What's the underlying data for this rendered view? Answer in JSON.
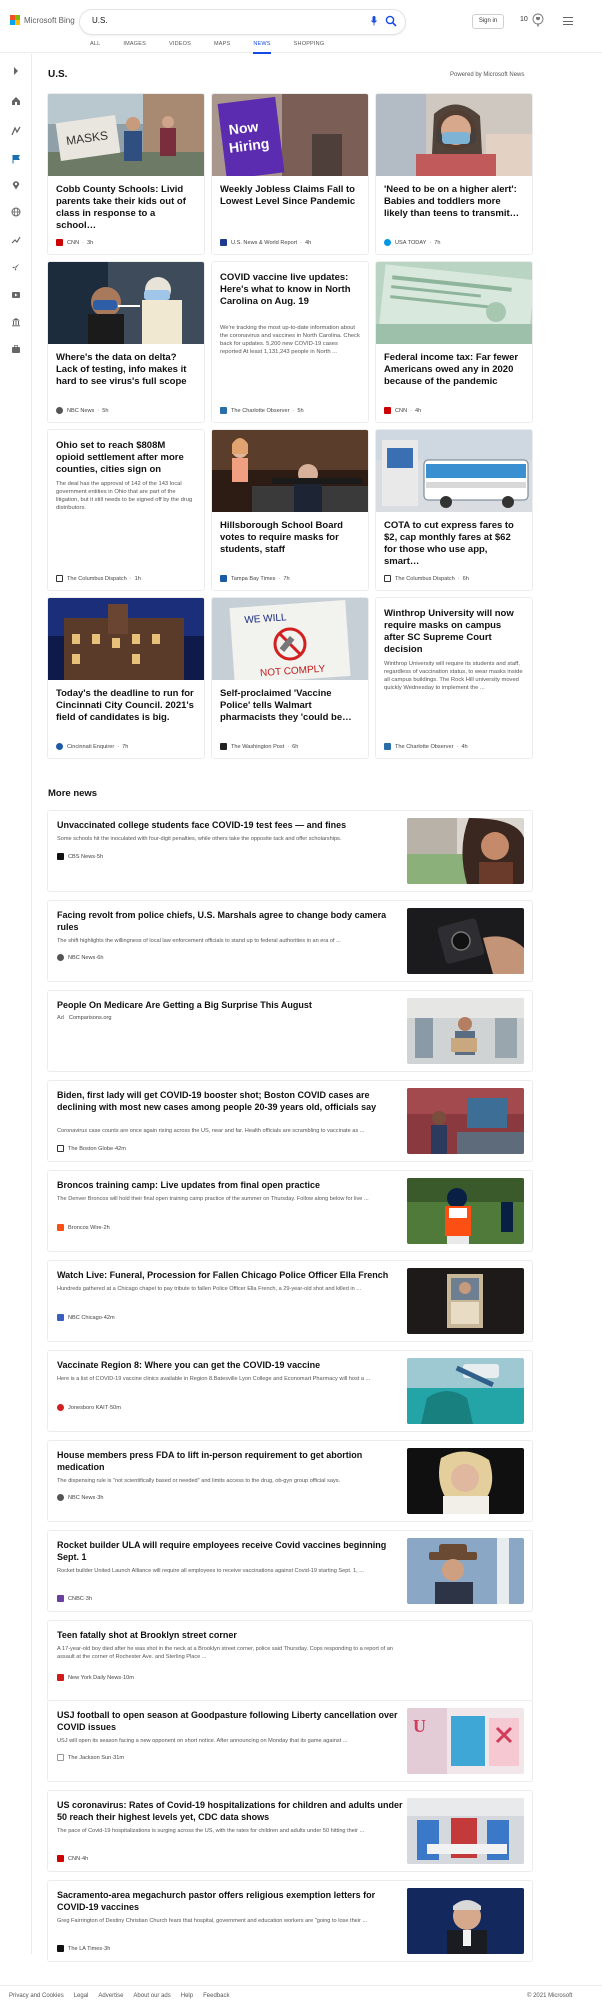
{
  "brand": {
    "logo_text": "Microsoft Bing",
    "logo_colors": [
      "#f25022",
      "#7fba00",
      "#00a4ef",
      "#ffb900"
    ],
    "accent": "#174ae4"
  },
  "search": {
    "value": "U.S."
  },
  "header": {
    "sign_in": "Sign in",
    "rewards_points": "10"
  },
  "tabs": [
    {
      "label": "ALL"
    },
    {
      "label": "IMAGES"
    },
    {
      "label": "VIDEOS"
    },
    {
      "label": "MAPS"
    },
    {
      "label": "NEWS",
      "active": true
    },
    {
      "label": "SHOPPING"
    }
  ],
  "section": {
    "title": "U.S.",
    "powered_by": "Powered by Microsoft News"
  },
  "cards": [
    {
      "title": "Cobb County Schools: Livid parents take their kids out of class in response to a school…",
      "source": "CNN",
      "time": "3h",
      "logo_color": "#cc0000"
    },
    {
      "title": "Weekly Jobless Claims Fall to Lowest Level Since Pandemic",
      "source": "U.S. News & World Report",
      "time": "4h",
      "logo_color": "#1f3a93"
    },
    {
      "title": "'Need to be on a higher alert': Babies and toddlers more likely than teens to transmit…",
      "source": "USA TODAY",
      "time": "7h",
      "logo_color": "#0098e3"
    },
    {
      "title": "Where's the data on delta? Lack of testing, info makes it hard to see virus's full scope",
      "source": "NBC News",
      "time": "5h",
      "logo_color": "#555555"
    },
    {
      "title": "COVID vaccine live updates: Here's what to know in North Carolina on Aug. 19",
      "snippet": "We're tracking the most up-to-date information about the coronavirus and vaccines in North Carolina. Check back for updates. 5,200 new COVID-19 cases reported At least 1,131,243 people in North ...",
      "source": "The Charlotte Observer",
      "time": "5h",
      "logo_color": "#2a6ea8"
    },
    {
      "title": "Federal income tax: Far fewer Americans owed any in 2020 because of the pandemic",
      "source": "CNN",
      "time": "4h",
      "logo_color": "#cc0000"
    },
    {
      "title": "Ohio set to reach $808M opioid settlement after more counties, cities sign on",
      "snippet": "The deal has the approval of 142 of the 143 local government entities in Ohio that are part of the litigation, but it still needs to be signed off by the drug distributors.",
      "source": "The Columbus Dispatch",
      "time": "1h",
      "logo_color": "#333333"
    },
    {
      "title": "Hillsborough School Board votes to require masks for students, staff",
      "source": "Tampa Bay Times",
      "time": "7h",
      "logo_color": "#1a5aa6"
    },
    {
      "title": "COTA to cut express fares to $2, cap monthly fares at $62 for those who use app, smart…",
      "source": "The Columbus Dispatch",
      "time": "6h",
      "logo_color": "#333333"
    },
    {
      "title": "Today's the deadline to run for Cincinnati City Council. 2021's field of candidates is big.",
      "source": "Cincinnati Enquirer",
      "time": "7h",
      "logo_color": "#1e5aa8"
    },
    {
      "title": "Self-proclaimed 'Vaccine Police' tells Walmart pharmacists they 'could be…",
      "source": "The Washington Post",
      "time": "6h",
      "logo_color": "#222222"
    },
    {
      "title": "Winthrop University will now require masks on campus after SC Supreme Court decision",
      "snippet": "Winthrop University will require its students and staff, regardless of vaccination status, to wear masks inside all campus buildings. The Rock Hill university moved quickly Wednesday to implement the ...",
      "source": "The Charlotte Observer",
      "time": "4h",
      "logo_color": "#2a6ea8"
    }
  ],
  "more_news": {
    "title": "More news",
    "items": [
      {
        "title": "Unvaccinated college students face COVID-19 test fees — and fines",
        "snippet": "Some schools hit the inoculated with four-digit penalties, while others take the opposite tack and offer scholarships.",
        "source": "CBS News",
        "time": "5h",
        "logo_color": "#111111"
      },
      {
        "title": "Facing revolt from police chiefs, U.S. Marshals agree to change body camera rules",
        "snippet": "The shift highlights the willingness of local law enforcement officials to stand up to federal authorities in an era of ...",
        "source": "NBC News",
        "time": "6h",
        "logo_color": "#555555"
      },
      {
        "title": "People On Medicare Are Getting a Big Surprise This August",
        "ad": "Ad",
        "source": "Comparisons.org"
      },
      {
        "title": "Biden, first lady will get COVID-19 booster shot; Boston COVID cases are declining with most new cases among people 20-39 years old, officials say",
        "snippet": "Coronavirus case counts are once again rising across the US, near and far. Health officials are scrambling to vaccinate as ...",
        "source": "The Boston Globe",
        "time": "42m",
        "logo_color": "#333333"
      },
      {
        "title": "Broncos training camp: Live updates from final open practice",
        "snippet": "The Denver Broncos will hold their final open training camp practice of the summer on Thursday. Follow along below for live ...",
        "source": "Broncos Wire",
        "time": "2h",
        "logo_color": "#fb4f14"
      },
      {
        "title": "Watch Live: Funeral, Procession for Fallen Chicago Police Officer Ella French",
        "snippet": "Hundreds gathered at a Chicago chapel to pay tribute to fallen Police Officer Ella French, a 29-year-old shot and killed in ...",
        "source": "NBC Chicago",
        "time": "42m",
        "logo_color": "#3b5fc0"
      },
      {
        "title": "Vaccinate Region 8: Where you can get the COVID-19 vaccine",
        "snippet": "Here is a list of COVID-19 vaccine clinics available in Region 8.Batesville Lyon College and Economart Pharmacy will host a ...",
        "source": "Jonesboro KAIT",
        "time": "50m",
        "logo_color": "#d22020"
      },
      {
        "title": "House members press FDA to lift in-person requirement to get abortion medication",
        "snippet": "The dispensing rule is \"not scientifically based or needed\" and limits access to the drug, ob-gyn group official says.",
        "source": "NBC News",
        "time": "3h",
        "logo_color": "#555555"
      },
      {
        "title": "Rocket builder ULA will require employees receive Covid vaccines beginning Sept. 1",
        "snippet": "Rocket builder United Launch Alliance will require all employees to receive vaccinations against Covid-19 starting Sept. 1, ...",
        "source": "CNBC",
        "time": "3h",
        "logo_color": "#6b3fa0"
      },
      {
        "title": "Teen fatally shot at Brooklyn street corner",
        "snippet": "A 17-year-old boy died after he was shot in the neck at a Brooklyn street corner, police said Thursday. Cops responding to a report of an assault at the corner of Rochester Ave. and Sterling Place ...",
        "source": "New York Daily News",
        "time": "10m",
        "logo_color": "#d11b1b"
      },
      {
        "title": "USJ football to open season at Goodpasture following Liberty cancellation over COVID issues",
        "snippet": "USJ will open its season facing a new opponent on short notice. After announcing on Monday that its game against ...",
        "source": "The Jackson Sun",
        "time": "31m",
        "logo_color": "#555555"
      },
      {
        "title": "US coronavirus: Rates of Covid-19 hospitalizations for children and adults under 50 reach their highest levels yet, CDC data shows",
        "snippet": "The pace of Covid-19 hospitalizations is surging across the US, with the rates for children and adults under 50 hitting their ...",
        "source": "CNN",
        "time": "4h",
        "logo_color": "#cc0000"
      },
      {
        "title": "Sacramento-area megachurch pastor offers religious exemption letters for COVID-19 vaccines",
        "snippet": "Greg Fairrington of Destiny Christian Church fears that hospital, government and education workers are \"going to lose their ...",
        "source": "The LA Times",
        "time": "3h",
        "logo_color": "#111111"
      }
    ]
  },
  "footer": {
    "links": [
      "Privacy and Cookies",
      "Legal",
      "Advertise",
      "About our ads",
      "Help",
      "Feedback"
    ],
    "copyright": "© 2021 Microsoft"
  }
}
